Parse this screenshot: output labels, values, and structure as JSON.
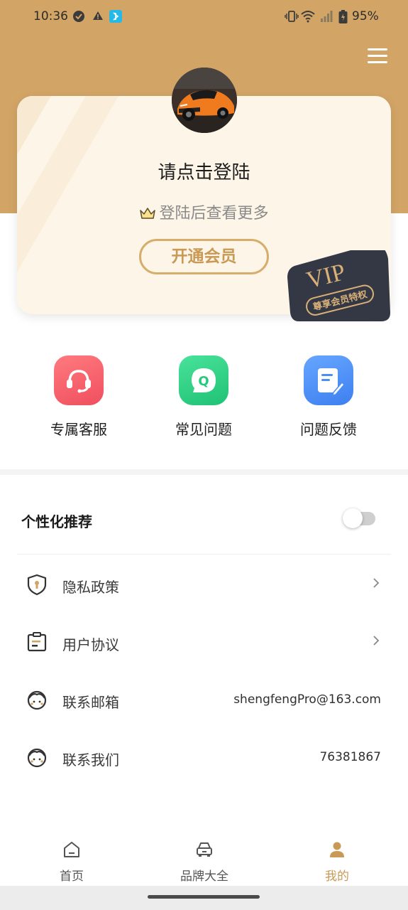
{
  "status_bar": {
    "time": "10:36",
    "battery": "95%"
  },
  "profile": {
    "login_prompt": "请点击登陆",
    "login_hint": "登陆后查看更多",
    "open_vip_label": "开通会员",
    "vip_badge_title": "VIP",
    "vip_badge_sub": "尊享会员特权"
  },
  "quick_actions": [
    {
      "label": "专属客服",
      "icon": "customer-service-icon",
      "color": "#f45f6a"
    },
    {
      "label": "常见问题",
      "icon": "faq-icon",
      "color": "#2ed084"
    },
    {
      "label": "问题反馈",
      "icon": "feedback-icon",
      "color": "#4b8ff5"
    }
  ],
  "settings": {
    "personalized_label": "个性化推荐",
    "personalized_on": false,
    "rows": [
      {
        "label": "隐私政策",
        "icon": "shield-icon",
        "value": ""
      },
      {
        "label": "用户协议",
        "icon": "agreement-icon",
        "value": ""
      },
      {
        "label": "联系邮箱",
        "icon": "support-agent-icon",
        "value": "shengfengPro@163.com"
      },
      {
        "label": "联系我们",
        "icon": "support-agent-icon",
        "value": "76381867"
      }
    ]
  },
  "tabs": [
    {
      "label": "首页",
      "icon": "home-icon",
      "active": false
    },
    {
      "label": "品牌大全",
      "icon": "car-icon",
      "active": false
    },
    {
      "label": "我的",
      "icon": "user-icon",
      "active": true
    }
  ],
  "colors": {
    "accent": "#d2a566",
    "card_bg": "#fdf5e7",
    "active_tab": "#c99a55"
  }
}
